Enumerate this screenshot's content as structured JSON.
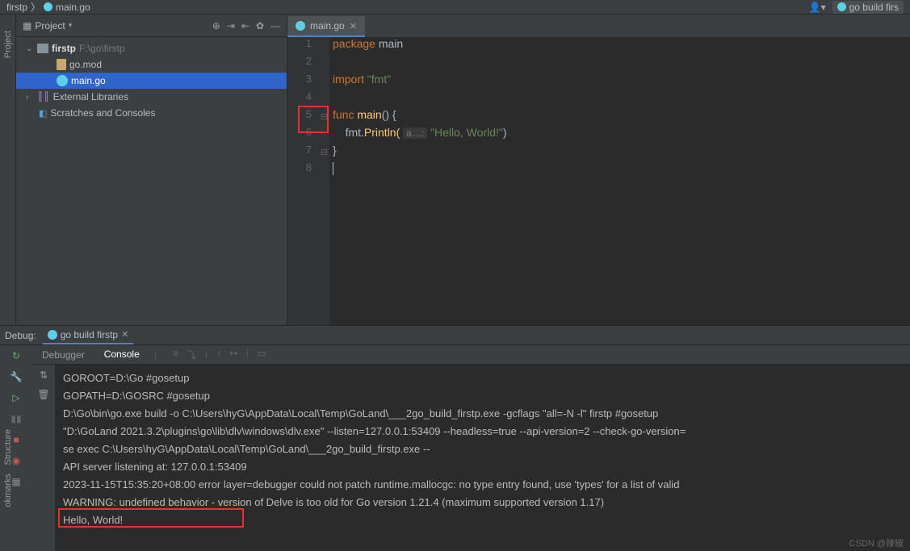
{
  "breadcrumbs": {
    "project": "firstp",
    "file": "main.go"
  },
  "top_right": {
    "run_config": "go build firs"
  },
  "sidebar": {
    "title": "Project",
    "items": [
      {
        "name": "firstp",
        "hint": "F:\\go\\firstp"
      },
      {
        "name": "go.mod"
      },
      {
        "name": "main.go"
      },
      {
        "name": "External Libraries"
      },
      {
        "name": "Scratches and Consoles"
      }
    ]
  },
  "tab": {
    "name": "main.go"
  },
  "code": {
    "kw_package": "package",
    "pkg_name": "main",
    "kw_import": "import",
    "import_str": "\"fmt\"",
    "kw_func": "func",
    "fn_main": "main",
    "parens_open": "() {",
    "fmt_id": "fmt",
    "print_fn": ".Println(",
    "hint": "a…:",
    "hello_str": "\"Hello, World!\"",
    "close_paren": ")",
    "brace_close": "}",
    "lines": [
      "1",
      "2",
      "3",
      "4",
      "5",
      "6",
      "7",
      "8"
    ]
  },
  "debug": {
    "title": "Debug:",
    "run_config": "go build firstp",
    "tabs": {
      "debugger": "Debugger",
      "console": "Console"
    },
    "console_lines": [
      "GOROOT=D:\\Go #gosetup",
      "GOPATH=D:\\GOSRC #gosetup",
      "D:\\Go\\bin\\go.exe build -o C:\\Users\\hyG\\AppData\\Local\\Temp\\GoLand\\___2go_build_firstp.exe -gcflags \"all=-N -l\" firstp #gosetup",
      "\"D:\\GoLand 2021.3.2\\plugins\\go\\lib\\dlv\\windows\\dlv.exe\" --listen=127.0.0.1:53409 --headless=true --api-version=2 --check-go-version=",
      "se exec C:\\Users\\hyG\\AppData\\Local\\Temp\\GoLand\\___2go_build_firstp.exe --",
      "API server listening at: 127.0.0.1:53409",
      "2023-11-15T15:35:20+08:00 error layer=debugger could not patch runtime.mallocgc: no type entry found, use 'types' for a list of valid",
      "WARNING: undefined behavior - version of Delve is too old for Go version 1.21.4 (maximum supported version 1.17)",
      "Hello, World!"
    ]
  },
  "left_gutter_labels": {
    "project": "Project",
    "structure": "Structure",
    "bookmarks": "okmarks"
  },
  "watermark": "CSDN @辣椒"
}
